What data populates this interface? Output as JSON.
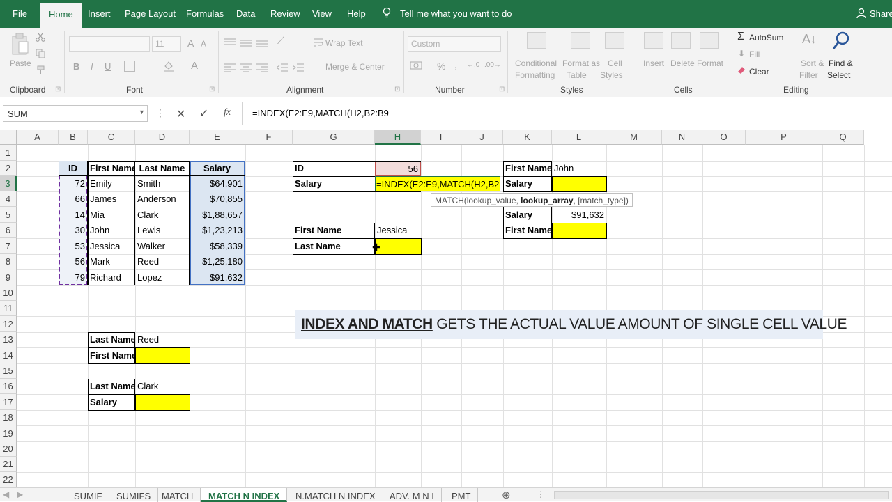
{
  "tabs": {
    "file": "File",
    "home": "Home",
    "insert": "Insert",
    "page_layout": "Page Layout",
    "formulas": "Formulas",
    "data": "Data",
    "review": "Review",
    "view": "View",
    "help": "Help",
    "tell_me": "Tell me what you want to do",
    "share": "Share"
  },
  "ribbon": {
    "clipboard": {
      "label": "Clipboard",
      "paste": "Paste"
    },
    "font": {
      "label": "Font",
      "size": "11",
      "bold": "B",
      "italic": "I",
      "underline": "U"
    },
    "alignment": {
      "label": "Alignment",
      "wrap_text": "Wrap Text",
      "merge_center": "Merge & Center"
    },
    "number": {
      "label": "Number",
      "format": "Custom",
      "percent": "%",
      "comma": ","
    },
    "styles": {
      "label": "Styles",
      "conditional_1": "Conditional",
      "conditional_2": "Formatting",
      "format_as_1": "Format as",
      "format_as_2": "Table",
      "cell_1": "Cell",
      "cell_2": "Styles"
    },
    "cells": {
      "label": "Cells",
      "insert": "Insert",
      "delete": "Delete",
      "format": "Format"
    },
    "editing": {
      "label": "Editing",
      "autosum": "AutoSum",
      "fill": "Fill",
      "clear": "Clear",
      "sort_1": "Sort &",
      "sort_2": "Filter",
      "find_1": "Find &",
      "find_2": "Select"
    }
  },
  "formula_bar": {
    "name_box": "SUM",
    "cancel": "✕",
    "enter": "✓",
    "fx": "fx",
    "formula": "=INDEX(E2:E9,MATCH(H2,B2:B9"
  },
  "columns": [
    "A",
    "B",
    "C",
    "D",
    "E",
    "F",
    "G",
    "H",
    "I",
    "J",
    "K",
    "L",
    "M",
    "N",
    "O",
    "P",
    "Q"
  ],
  "rows": [
    "1",
    "2",
    "3",
    "4",
    "5",
    "6",
    "7",
    "8",
    "9",
    "10",
    "11",
    "12",
    "13",
    "14",
    "15",
    "16",
    "17",
    "18",
    "19",
    "20",
    "21",
    "22"
  ],
  "table": {
    "headers": [
      "ID",
      "First Name",
      "Last Name",
      "Salary"
    ],
    "rows": [
      [
        "72",
        "Emily",
        "Smith",
        "$64,901"
      ],
      [
        "66",
        "James",
        "Anderson",
        "$70,855"
      ],
      [
        "14",
        "Mia",
        "Clark",
        "$1,88,657"
      ],
      [
        "30",
        "John",
        "Lewis",
        "$1,23,213"
      ],
      [
        "53",
        "Jessica",
        "Walker",
        "$58,339"
      ],
      [
        "56",
        "Mark",
        "Reed",
        "$1,25,180"
      ],
      [
        "79",
        "Richard",
        "Lopez",
        "$91,632"
      ]
    ]
  },
  "lookup_id": {
    "label1": "ID",
    "value1": "56",
    "label2": "Salary",
    "editing_formula": "=INDEX(E2:E9,MATCH(H2,B2:B9"
  },
  "tooltip": {
    "prefix": "MATCH(lookup_value, ",
    "bold": "lookup_array",
    "suffix": ", [match_type])"
  },
  "lookup_first": {
    "label1": "First Name",
    "value1": "Jessica",
    "label2": "Last Name"
  },
  "lookup_k1": {
    "label1": "First Name",
    "value1": "John",
    "label2": "Salary"
  },
  "lookup_k2": {
    "label1": "Salary",
    "value1": "$91,632",
    "label2": "First Name"
  },
  "lookup_c13": {
    "label1": "Last Name",
    "value1": "Reed",
    "label2": "First Name"
  },
  "lookup_c16": {
    "label1": "Last Name",
    "value1": "Clark",
    "label2": "Salary"
  },
  "banner": {
    "bold": "INDEX AND MATCH",
    "rest": " GETS THE ACTUAL VALUE AMOUNT OF SINGLE CELL VALUE"
  },
  "sheets": [
    "SUMIF",
    "SUMIFS",
    "MATCH",
    "MATCH N INDEX",
    "N.MATCH N INDEX",
    "ADV. M N I",
    "PMT"
  ],
  "add_sheet": "⊕",
  "colors": {
    "excel_green": "#217346",
    "highlight_yellow": "#ffff00",
    "selection_blue": "#dce6f2",
    "banner_bg": "#e8eef7"
  }
}
